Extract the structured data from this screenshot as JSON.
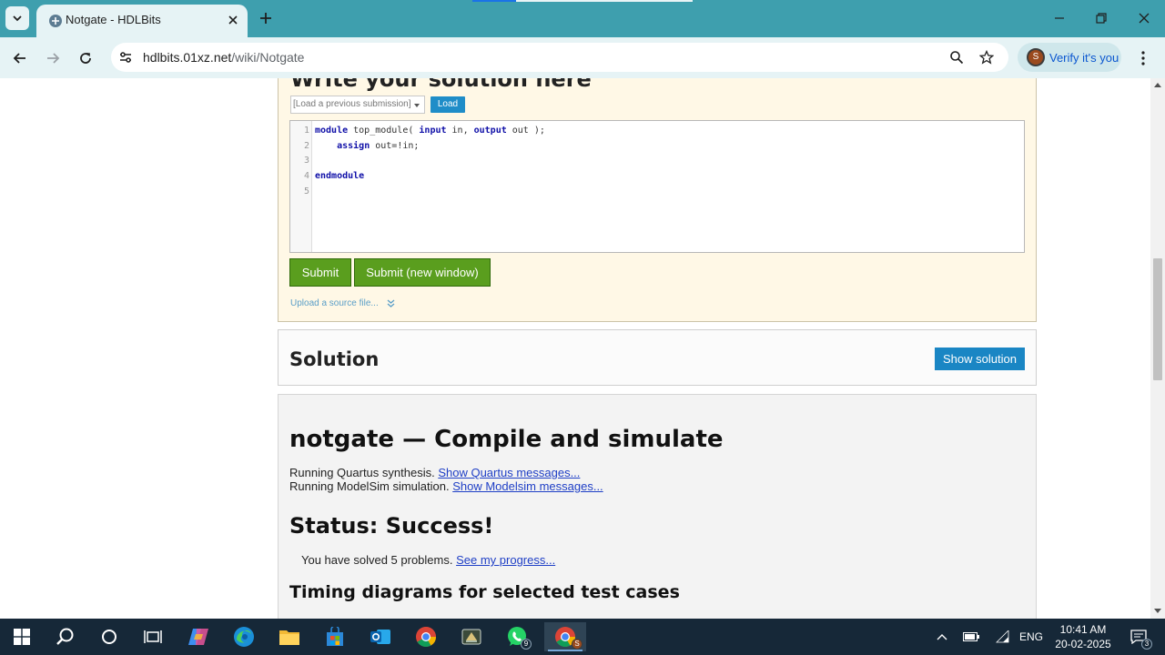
{
  "browser": {
    "tab_title": "Notgate - HDLBits",
    "url_host": "hdlbits.01xz.net",
    "url_path": "/wiki/Notgate",
    "profile_label": "Verify it's you",
    "profile_initial": "S"
  },
  "editor_section": {
    "heading": "Write your solution here",
    "previous_submission_placeholder": "[Load a previous submission]",
    "load_button": "Load",
    "line_numbers": [
      "1",
      "2",
      "3",
      "4",
      "5"
    ],
    "code": {
      "l1_kw_module": "module",
      "l1_a": " top_module( ",
      "l1_kw_input": "input",
      "l1_b": " in, ",
      "l1_kw_output": "output",
      "l1_c": " out );",
      "l2_indent": "    ",
      "l2_kw_assign": "assign",
      "l2_rest": " out=!in;",
      "l4_kw_endmodule": "endmodule"
    },
    "submit_button": "Submit",
    "submit_new_window_button": "Submit (new window)",
    "upload_link": "Upload a source file..."
  },
  "solution_section": {
    "title": "Solution",
    "show_button": "Show solution"
  },
  "result_section": {
    "title": "notgate — Compile and simulate",
    "quartus_text": "Running Quartus synthesis.",
    "quartus_link": "Show Quartus messages...",
    "modelsim_text": "Running ModelSim simulation.",
    "modelsim_link": "Show Modelsim messages...",
    "status": "Status: Success!",
    "solved_text": "You have solved 5 problems.",
    "progress_link": "See my progress...",
    "timing_heading": "Timing diagrams for selected test cases"
  },
  "taskbar": {
    "whatsapp_badge": "9",
    "chrome_profile_badge": "S",
    "language": "ENG",
    "time": "10:41 AM",
    "date": "20-02-2025",
    "notification_count": "3"
  },
  "colors": {
    "tabstrip": "#3e9fae",
    "toolbar": "#e6f3f5",
    "submit_green": "#5a9e1e",
    "button_blue": "#1a86c4",
    "editor_panel": "#fff8e6",
    "taskbar": "#162838"
  }
}
